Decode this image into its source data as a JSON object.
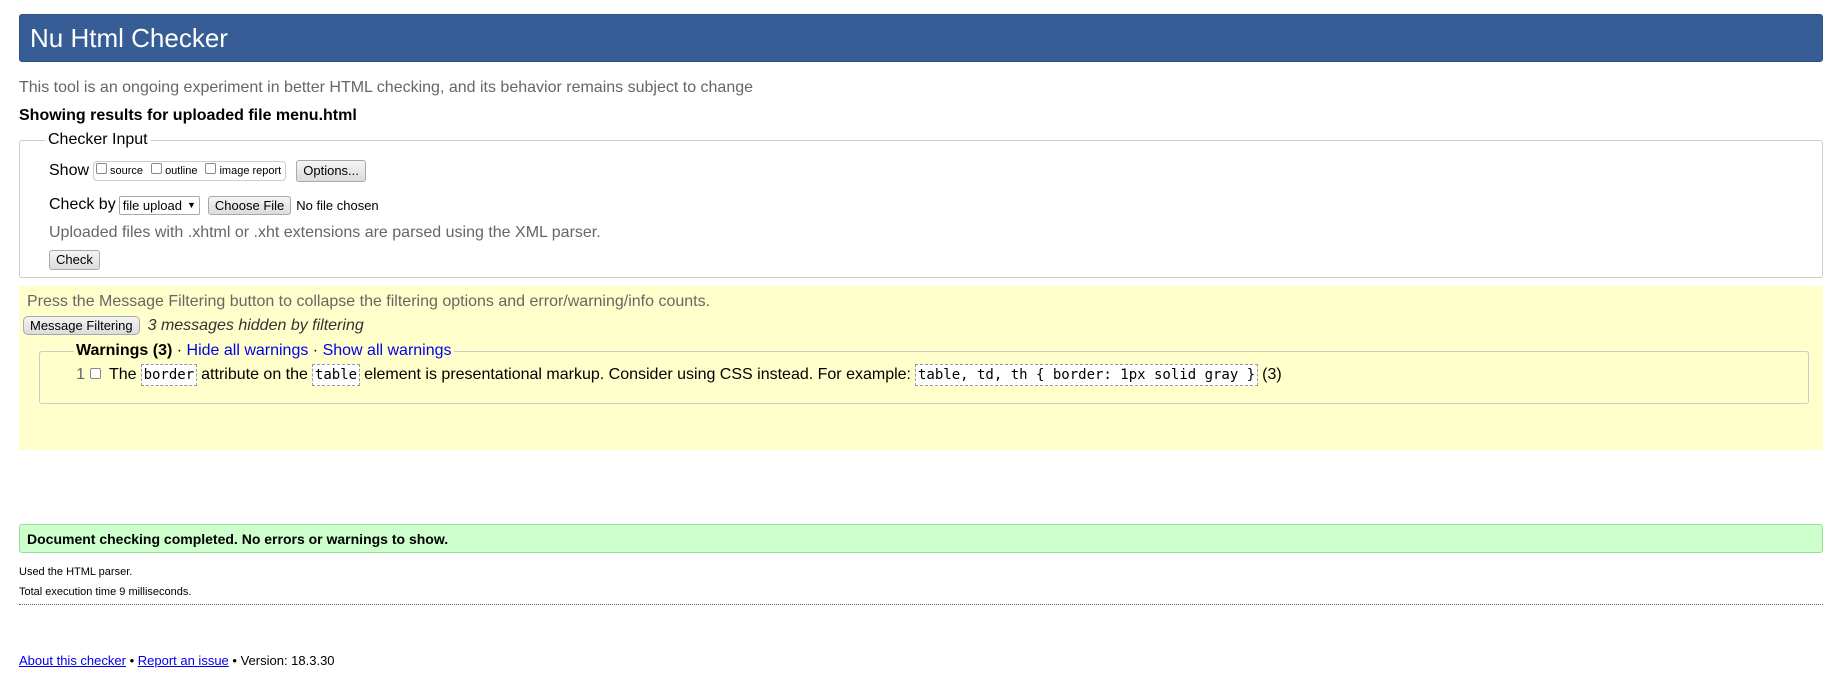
{
  "header": {
    "title": "Nu Html Checker"
  },
  "intro": "This tool is an ongoing experiment in better HTML checking, and its behavior remains subject to change",
  "showing_results": "Showing results for uploaded file menu.html",
  "checker_input": {
    "legend": "Checker Input",
    "show_label": "Show",
    "show_options": [
      {
        "label": "source",
        "checked": false
      },
      {
        "label": "outline",
        "checked": false
      },
      {
        "label": "image report",
        "checked": false
      }
    ],
    "options_button": "Options...",
    "check_by_label": "Check by",
    "check_by_selected": "file upload",
    "choose_file_button": "Choose File",
    "no_file_text": "No file chosen",
    "hint": "Uploaded files with .xhtml or .xht extensions are parsed using the XML parser.",
    "check_button": "Check"
  },
  "filtering": {
    "press_text": "Press the Message Filtering button to collapse the filtering options and error/warning/info counts.",
    "filter_button": "Message Filtering",
    "hidden_text": "3 messages hidden by filtering",
    "warnings_title": "Warnings (3)",
    "separator": " · ",
    "hide_all": "Hide all warnings",
    "show_all": "Show all warnings",
    "items": [
      {
        "number": "1",
        "text_1": "The",
        "code_1": "border",
        "text_2": "attribute on the",
        "code_2": "table",
        "text_3": "element is presentational markup. Consider using CSS instead. For example:",
        "code_3": "table, td, th { border: 1px solid gray }",
        "count": "(3)"
      }
    ]
  },
  "result": {
    "success": "Document checking completed. No errors or warnings to show.",
    "parser": "Used the HTML parser.",
    "time": "Total execution time 9 milliseconds."
  },
  "footer": {
    "about": "About this checker",
    "bullet": " • ",
    "report": "Report an issue",
    "version": "Version: 18.3.30"
  }
}
